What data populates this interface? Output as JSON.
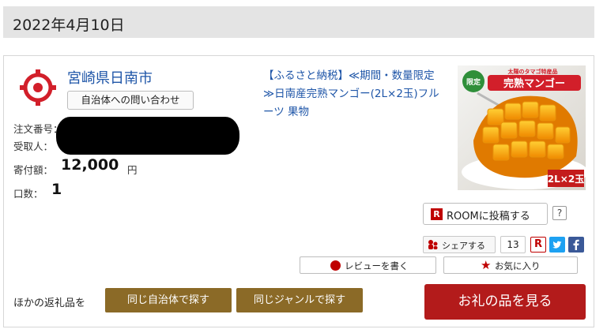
{
  "date": "2022年4月10日",
  "municipality": {
    "name": "宮崎県日南市",
    "contact_label": "自治体への問い合わせ"
  },
  "order": {
    "order_no_label": "注文番号：",
    "recipient_label": "受取人：",
    "amount_label": "寄付額：",
    "amount_value": "12,000",
    "amount_unit": "円",
    "qty_label": "口数：",
    "qty_value": "1"
  },
  "product": {
    "title": "【ふるさと納税】≪期間・数量限定≫日南産完熟マンゴー(2L×2玉)フルーツ 果物",
    "image_badge_left": "限定",
    "image_badge_title": "完熟マンゴー",
    "image_top_text": "太陽のタマゴ特産品",
    "image_size_label": "2L×2玉"
  },
  "actions": {
    "room_icon": "R",
    "room_label": "ROOMに投稿する",
    "help_label": "?",
    "share_label": "シェアする",
    "share_count": "13",
    "rakuten_icon": "R",
    "review_label": "レビューを書く",
    "favorite_label": "お気に入り"
  },
  "footer": {
    "other_label": "ほかの返礼品を",
    "same_city_label": "同じ自治体で探す",
    "same_genre_label": "同じジャンルで探す",
    "view_label": "お礼の品を見る"
  },
  "colors": {
    "link_blue": "#1f56a8",
    "brown": "#8b6a27",
    "rakuten_red": "#b31b1b"
  }
}
